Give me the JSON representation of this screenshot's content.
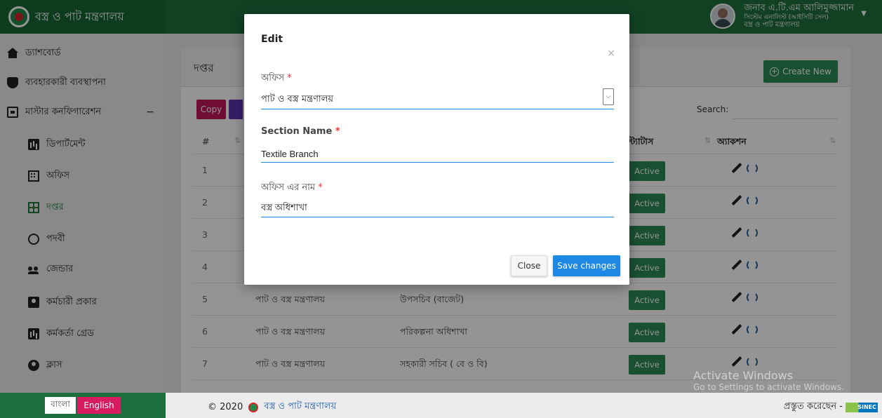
{
  "header": {
    "brand": "বস্ত্র ও পাট মন্ত্রণালয়",
    "user_name": "জনাব এ.টি.এম আলিমুজ্জামান",
    "user_role": "সিস্টেম এনালিস্ট (আইসিটি সেল)",
    "user_org": "বস্ত্র ও পাট মন্ত্রণালয়"
  },
  "sidebar": {
    "items": [
      {
        "label": "ড্যাশবোর্ড",
        "icon": "home-icon"
      },
      {
        "label": "ব্যবহারকারী ব্যবস্থাপনা",
        "icon": "shield-icon"
      },
      {
        "label": "মাস্টার কনফিগারেশন",
        "icon": "monitor-icon",
        "toggle": "−"
      },
      {
        "label": "ডিপার্টমেন্ট",
        "icon": "chart-icon"
      },
      {
        "label": "অফিস",
        "icon": "building-icon"
      },
      {
        "label": "দপ্তর",
        "icon": "grid-icon"
      },
      {
        "label": "পদবী",
        "icon": "wheelchair-icon"
      },
      {
        "label": "জেন্ডার",
        "icon": "users-icon"
      },
      {
        "label": "কর্মচারী প্রকার",
        "icon": "badge-icon"
      },
      {
        "label": "কর্মকর্তা গ্রেড",
        "icon": "chart-icon"
      },
      {
        "label": "ক্লাস",
        "icon": "person-icon"
      }
    ]
  },
  "main": {
    "title": "দপ্তর",
    "create_label": "Create New",
    "copy_label": "Copy",
    "search_label": "Search:",
    "table": {
      "headers": {
        "num": "#",
        "status": "স্ট্যাটাস",
        "action": "অ্যাকশন"
      },
      "rows": [
        {
          "num": "1",
          "office": "",
          "name": "",
          "status": "Active"
        },
        {
          "num": "2",
          "office": "",
          "name": "",
          "status": "Active"
        },
        {
          "num": "3",
          "office": "",
          "name": "",
          "status": "Active"
        },
        {
          "num": "4",
          "office": "",
          "name": "",
          "status": "Active"
        },
        {
          "num": "5",
          "office": "পাট ও বস্ত্র মন্ত্রণালয়",
          "name": "উপসচিব (বাজেট)",
          "status": "Active"
        },
        {
          "num": "6",
          "office": "পাট ও বস্ত্র মন্ত্রণালয়",
          "name": "পরিকল্পনা অধিশাখা",
          "status": "Active"
        },
        {
          "num": "7",
          "office": "পাট ও বস্ত্র মন্ত্রণালয়",
          "name": "সহকারী সচিব ( বে ও বি)",
          "status": "Active"
        }
      ]
    }
  },
  "modal": {
    "title": "Edit",
    "close_x": "×",
    "office_label": "অফিস",
    "office_value": "পাট ও বস্ত্র মন্ত্রণালয়",
    "section_label": "Section Name",
    "section_value": "Textile Branch",
    "office_name_label": "অফিস এর নাম",
    "office_name_value": "বস্ত্র অধিশাখা",
    "required_mark": "*",
    "close_button": "Close",
    "save_button": "Save changes"
  },
  "footer": {
    "lang_bn": "বাংলা",
    "lang_en": "English",
    "copyright": "© 2020",
    "org": "বস্ত্র ও পাট মন্ত্রণালয়",
    "made_by": "প্রস্তুত করেছেন -",
    "vendor_logo": "SINEC"
  },
  "watermark": {
    "line1": "Activate Windows",
    "line2": "Go to Settings to activate Windows."
  },
  "colors": {
    "header_green": "#1e6f3d",
    "status_green": "#2e8b57",
    "primary_blue": "#1e88e5",
    "english_pink": "#d81b60"
  }
}
